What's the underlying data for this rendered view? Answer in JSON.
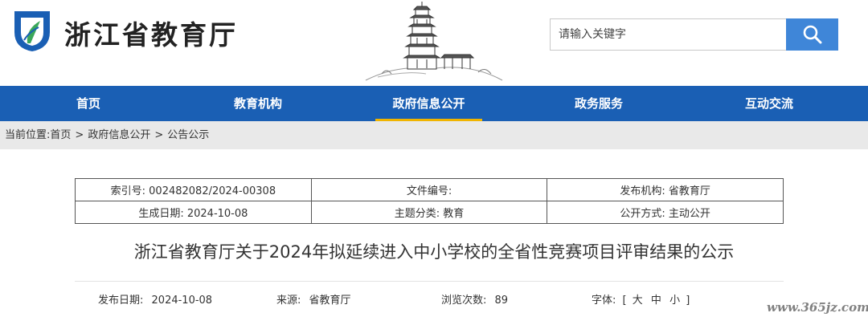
{
  "header": {
    "site_title": "浙江省教育厅",
    "search_placeholder": "请输入关键字",
    "brand_color": "#1a5fb4",
    "search_button_color": "#3f86d8"
  },
  "nav": {
    "items": [
      {
        "label": "首页",
        "active": false
      },
      {
        "label": "教育机构",
        "active": false
      },
      {
        "label": "政府信息公开",
        "active": true
      },
      {
        "label": "政务服务",
        "active": false
      },
      {
        "label": "互动交流",
        "active": false
      }
    ],
    "active_underline_color": "#f0b400"
  },
  "breadcrumb": {
    "prefix": "当前位置:",
    "items": [
      "首页",
      "政府信息公开",
      "公告公示"
    ],
    "separator": ">"
  },
  "meta": {
    "index_no": "索引号: 002482082/2024-00308",
    "doc_no": "文件编号:",
    "publisher": "发布机构: 省教育厅",
    "created": "生成日期: 2024-10-08",
    "topic": "主题分类: 教育",
    "open_mode": "公开方式: 主动公开"
  },
  "article": {
    "title": "浙江省教育厅关于2024年拟延续进入中小学校的全省性竞赛项目评审结果的公示",
    "publish_date_label": "发布日期:",
    "publish_date": "2024-10-08",
    "source_label": "来源:",
    "source": "省教育厅",
    "views_label": "浏览次数:",
    "views": "89",
    "font_label": "字体:",
    "font_open": "[",
    "font_large": "大",
    "font_medium": "中",
    "font_small": "小",
    "font_close": "]"
  },
  "watermark": "www.365jz.com"
}
